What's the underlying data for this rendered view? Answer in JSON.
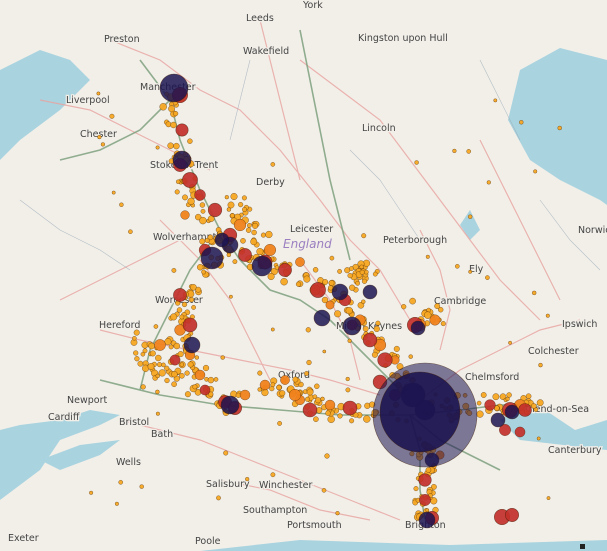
{
  "map": {
    "cities": [
      {
        "name": "York"
      },
      {
        "name": "Leeds"
      },
      {
        "name": "Preston"
      },
      {
        "name": "Wakefield"
      },
      {
        "name": "Kingston upon Hull"
      },
      {
        "name": "Liverpool"
      },
      {
        "name": "Manchester"
      },
      {
        "name": "Chester"
      },
      {
        "name": "Lincoln"
      },
      {
        "name": "Stoke-on-Trent"
      },
      {
        "name": "Derby"
      },
      {
        "name": "Leicester"
      },
      {
        "name": "Wolverhampton"
      },
      {
        "name": "Peterborough"
      },
      {
        "name": "Norwich"
      },
      {
        "name": "Ely"
      },
      {
        "name": "Cambridge"
      },
      {
        "name": "Worcester"
      },
      {
        "name": "Hereford"
      },
      {
        "name": "Milton Keynes"
      },
      {
        "name": "Ipswich"
      },
      {
        "name": "Colchester"
      },
      {
        "name": "Chelmsford"
      },
      {
        "name": "Oxford"
      },
      {
        "name": "Newport"
      },
      {
        "name": "Southend-on-Sea"
      },
      {
        "name": "Cardiff"
      },
      {
        "name": "Bristol"
      },
      {
        "name": "Bath"
      },
      {
        "name": "Canterbury"
      },
      {
        "name": "Wells"
      },
      {
        "name": "Salisbury"
      },
      {
        "name": "Winchester"
      },
      {
        "name": "Southampton"
      },
      {
        "name": "Portsmouth"
      },
      {
        "name": "Brighton"
      },
      {
        "name": "Exeter"
      },
      {
        "name": "Poole"
      }
    ],
    "region_label": "England",
    "colors": {
      "sea": "#a9d3df",
      "land": "#f2efe9",
      "motorway": "#7fa17f",
      "aroad": "#e9a3a0",
      "large_cluster": "#1c1450",
      "medium_cluster": "#c2302a",
      "small_cluster": "#f0821c",
      "point": "#f6a623"
    }
  }
}
